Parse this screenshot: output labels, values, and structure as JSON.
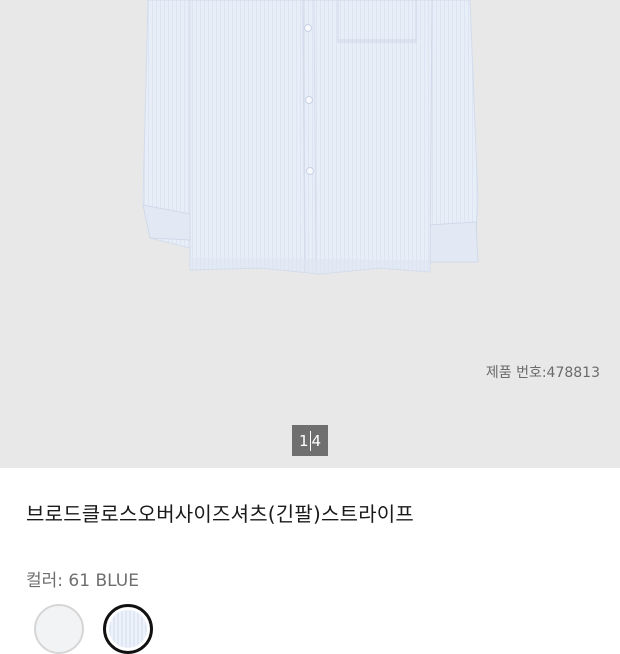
{
  "gallery": {
    "product_number": "제품 번호:478813",
    "pager": {
      "current": "1",
      "total": "4"
    },
    "image_subject": "shirt-image"
  },
  "product": {
    "title": "브로드클로스오버사이즈셔츠(긴팔)스트라이프",
    "color_label": "컬러:",
    "color_value": "61 BLUE"
  },
  "swatches": [
    {
      "name": "white",
      "color": "#f2f3f5",
      "selected": false
    },
    {
      "name": "blue-stripe",
      "color": "#e4eaf6",
      "selected": true
    }
  ],
  "colors": {
    "gallery_bg": "#e8e8e8",
    "shirt": "#e7edf7",
    "shirt_shadow": "#d5deee",
    "pager_bg": "#6f6f6f",
    "text_main": "#1a1a1a",
    "text_muted": "#6e6e6e"
  }
}
